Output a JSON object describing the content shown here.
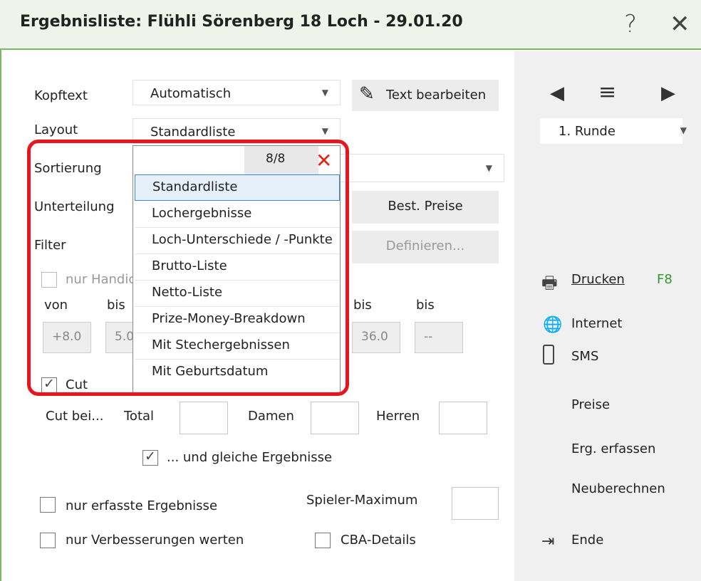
{
  "window": {
    "title": "Ergebnisliste: Flühli Sörenberg 18 Loch - 29.01.20",
    "help_label": "?",
    "close_label": "✕"
  },
  "form": {
    "kopftext": {
      "label": "Kopftext",
      "value": "Automatisch",
      "edit_button": "Text bearbeiten"
    },
    "layout": {
      "label": "Layout",
      "value": "Standardliste"
    },
    "sortierung": {
      "label": "Sortierung",
      "value": ""
    },
    "unterteilung": {
      "label": "Unterteilung",
      "button": "Best. Preise"
    },
    "filter": {
      "label": "Filter",
      "button": "Definieren..."
    },
    "nur_handicap": {
      "label": "nur Handicap",
      "checked": false
    },
    "von_bis": {
      "von": "von",
      "bis1": "bis",
      "bis2": "bis",
      "bis3": "bis",
      "val1": "+8.0",
      "val2": "5.0",
      "val3": "36.0",
      "val4": "--"
    },
    "cut": {
      "label": "Cut",
      "checked": true
    },
    "cut_bei": {
      "label": "Cut bei...",
      "total": "Total",
      "damen": "Damen",
      "herren": "Herren"
    },
    "gleiche": {
      "label": "... und gleiche Ergebnisse",
      "checked": true
    },
    "nur_erfasste": {
      "label": "nur erfasste Ergebnisse",
      "checked": false
    },
    "spieler_maximum": {
      "label": "Spieler-Maximum"
    },
    "nur_verbesserungen": {
      "label": "nur Verbesserungen werten",
      "checked": false
    },
    "cba": {
      "label": "CBA-Details",
      "checked": false
    }
  },
  "dropdown": {
    "count": "8/8",
    "items": [
      "Standardliste",
      "Lochergebnisse",
      "Loch-Unterschiede / -Punkte",
      "Brutto-Liste",
      "Netto-Liste",
      "Prize-Money-Breakdown",
      "Mit Stechergebnissen",
      "Mit Geburtsdatum"
    ],
    "selected": "Standardliste"
  },
  "right_panel": {
    "runde": "1. Runde",
    "drucken": "Drucken",
    "drucken_shortcut": "F8",
    "internet": "Internet",
    "sms": "SMS",
    "preise": "Preise",
    "erg_erfassen": "Erg. erfassen",
    "neuberechnen": "Neuberechnen",
    "ende": "Ende"
  },
  "colors": {
    "accent_green": "#7cb765",
    "highlight_red": "#e8141f",
    "shortcut_green": "#2e9a2e"
  }
}
